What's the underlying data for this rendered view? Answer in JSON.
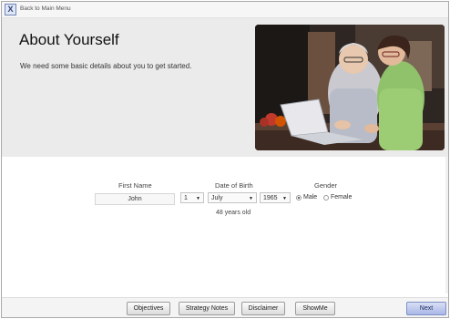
{
  "topbar": {
    "close_label": "X",
    "back_label": "Back to Main Menu"
  },
  "header": {
    "title": "About Yourself",
    "subtitle": "We need some basic details about you to get started."
  },
  "form": {
    "first_name_label": "First Name",
    "first_name_value": "John",
    "dob_label": "Date of Birth",
    "day": "1",
    "month": "July",
    "year": "1965",
    "gender_label": "Gender",
    "gender_options": [
      "Male",
      "Female"
    ],
    "gender_selected": "Male",
    "age_text": "48 years old"
  },
  "footer": {
    "buttons": [
      "Objectives",
      "Strategy Notes",
      "Disclaimer",
      "ShowMe"
    ],
    "next_label": "Next"
  },
  "colors": {
    "accent": "#a9b7e6",
    "header_bg": "#ebebeb"
  }
}
